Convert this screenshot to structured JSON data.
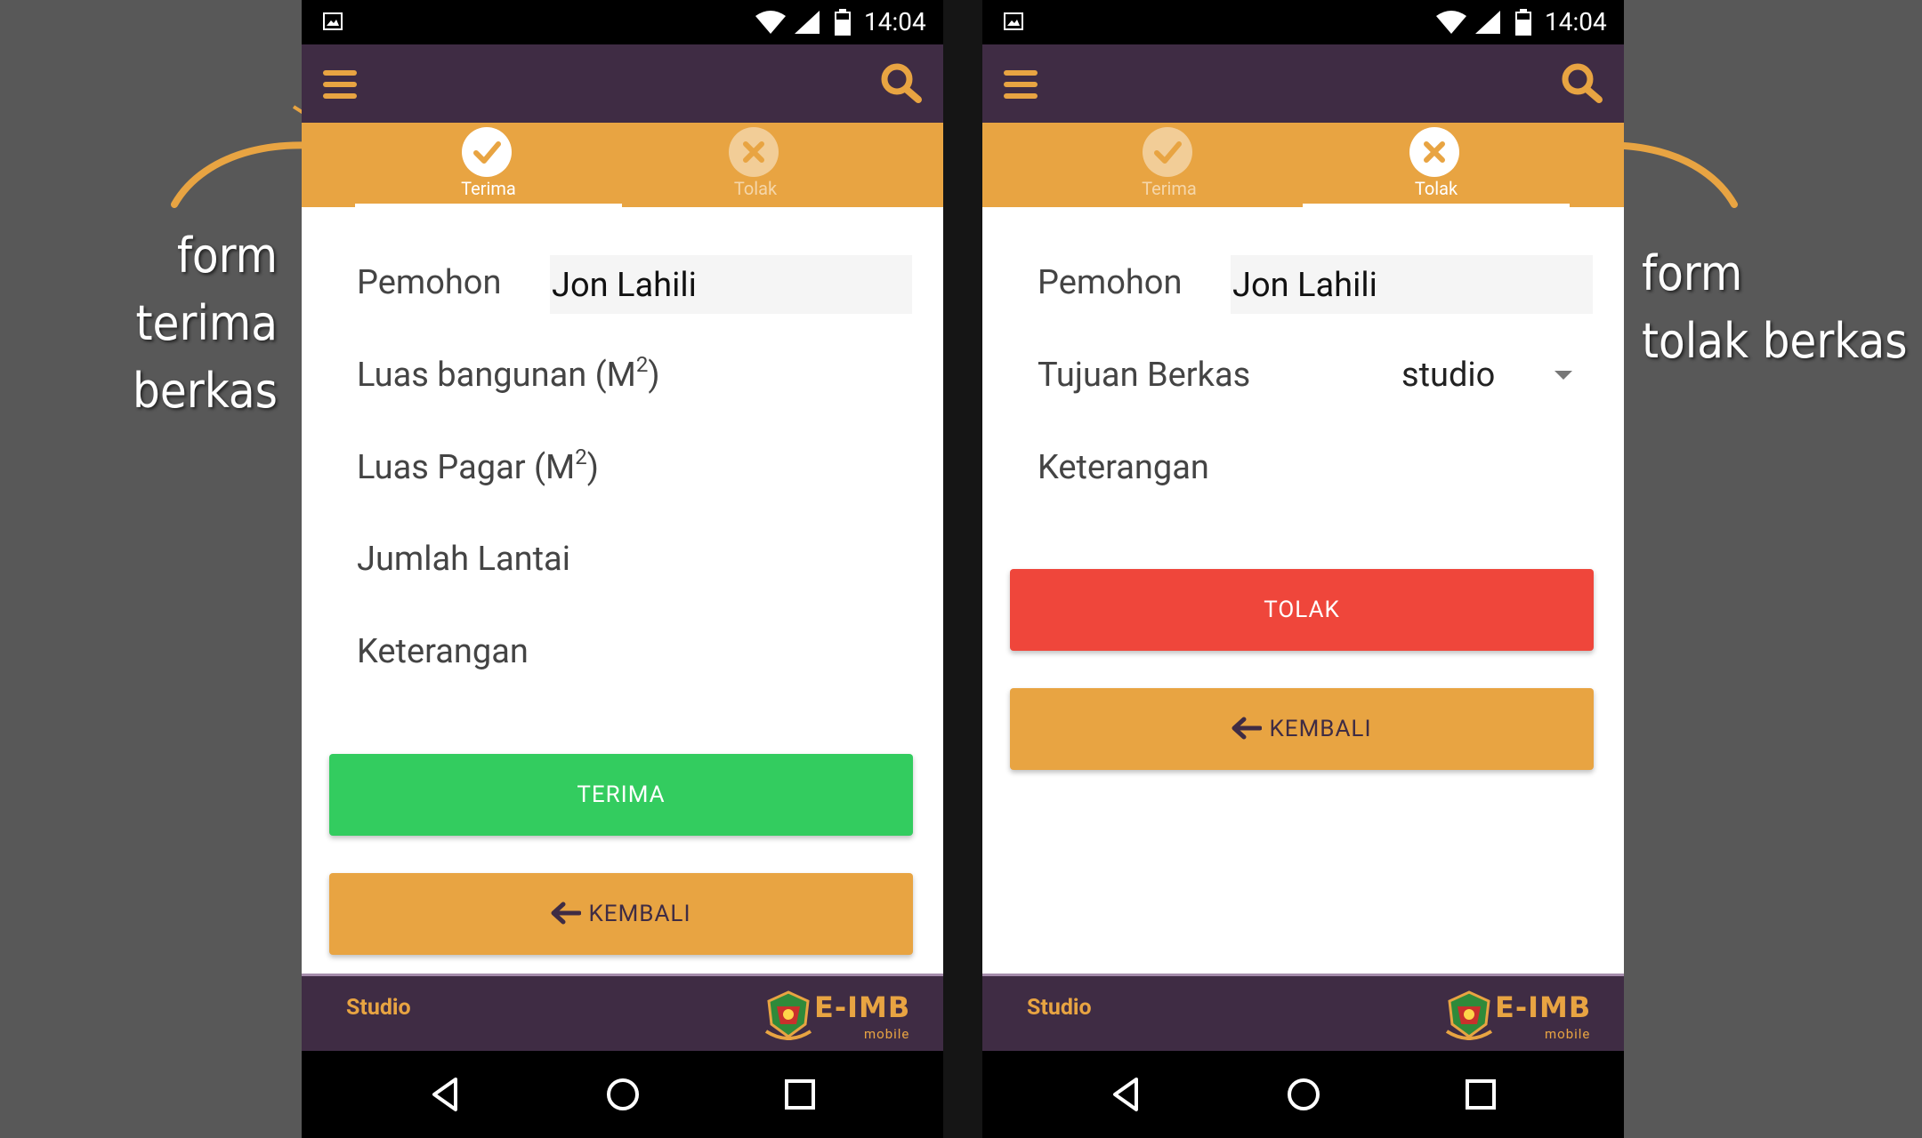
{
  "status_bar": {
    "time": "14:04"
  },
  "left_phone": {
    "tabs": [
      {
        "label": "Terima",
        "icon": "check-icon",
        "active": true
      },
      {
        "label": "Tolak",
        "icon": "close-icon",
        "active": false
      }
    ],
    "form": {
      "pemohon_label": "Pemohon",
      "pemohon_value": "Jon Lahili",
      "luas_bangunan_label": "Luas bangunan (M",
      "luas_bangunan_sup": "2",
      "luas_bangunan_close": ")",
      "luas_pagar_label": "Luas Pagar (M",
      "luas_pagar_sup": "2",
      "luas_pagar_close": ")",
      "jumlah_lantai_label": "Jumlah Lantai",
      "keterangan_label": "Keterangan"
    },
    "primary_button": "TERIMA",
    "back_button": "KEMBALI",
    "footer_text": "Studio"
  },
  "right_phone": {
    "tabs": [
      {
        "label": "Terima",
        "icon": "check-icon",
        "active": false
      },
      {
        "label": "Tolak",
        "icon": "close-icon",
        "active": true
      }
    ],
    "form": {
      "pemohon_label": "Pemohon",
      "pemohon_value": "Jon Lahili",
      "tujuan_label": "Tujuan Berkas",
      "tujuan_value": "studio",
      "keterangan_label": "Keterangan"
    },
    "primary_button": "TOLAK",
    "back_button": "KEMBALI",
    "footer_text": "Studio"
  },
  "logo": {
    "name": "E-IMB",
    "sub": "mobile"
  },
  "annotations": {
    "left_line1": "form",
    "left_line2": "terima berkas",
    "right_line1": "form",
    "right_line2": "tolak berkas"
  },
  "colors": {
    "app_bar": "#3f2c44",
    "accent_orange": "#e8a442",
    "accept_green": "#33cc5f",
    "reject_red": "#ef463b"
  }
}
